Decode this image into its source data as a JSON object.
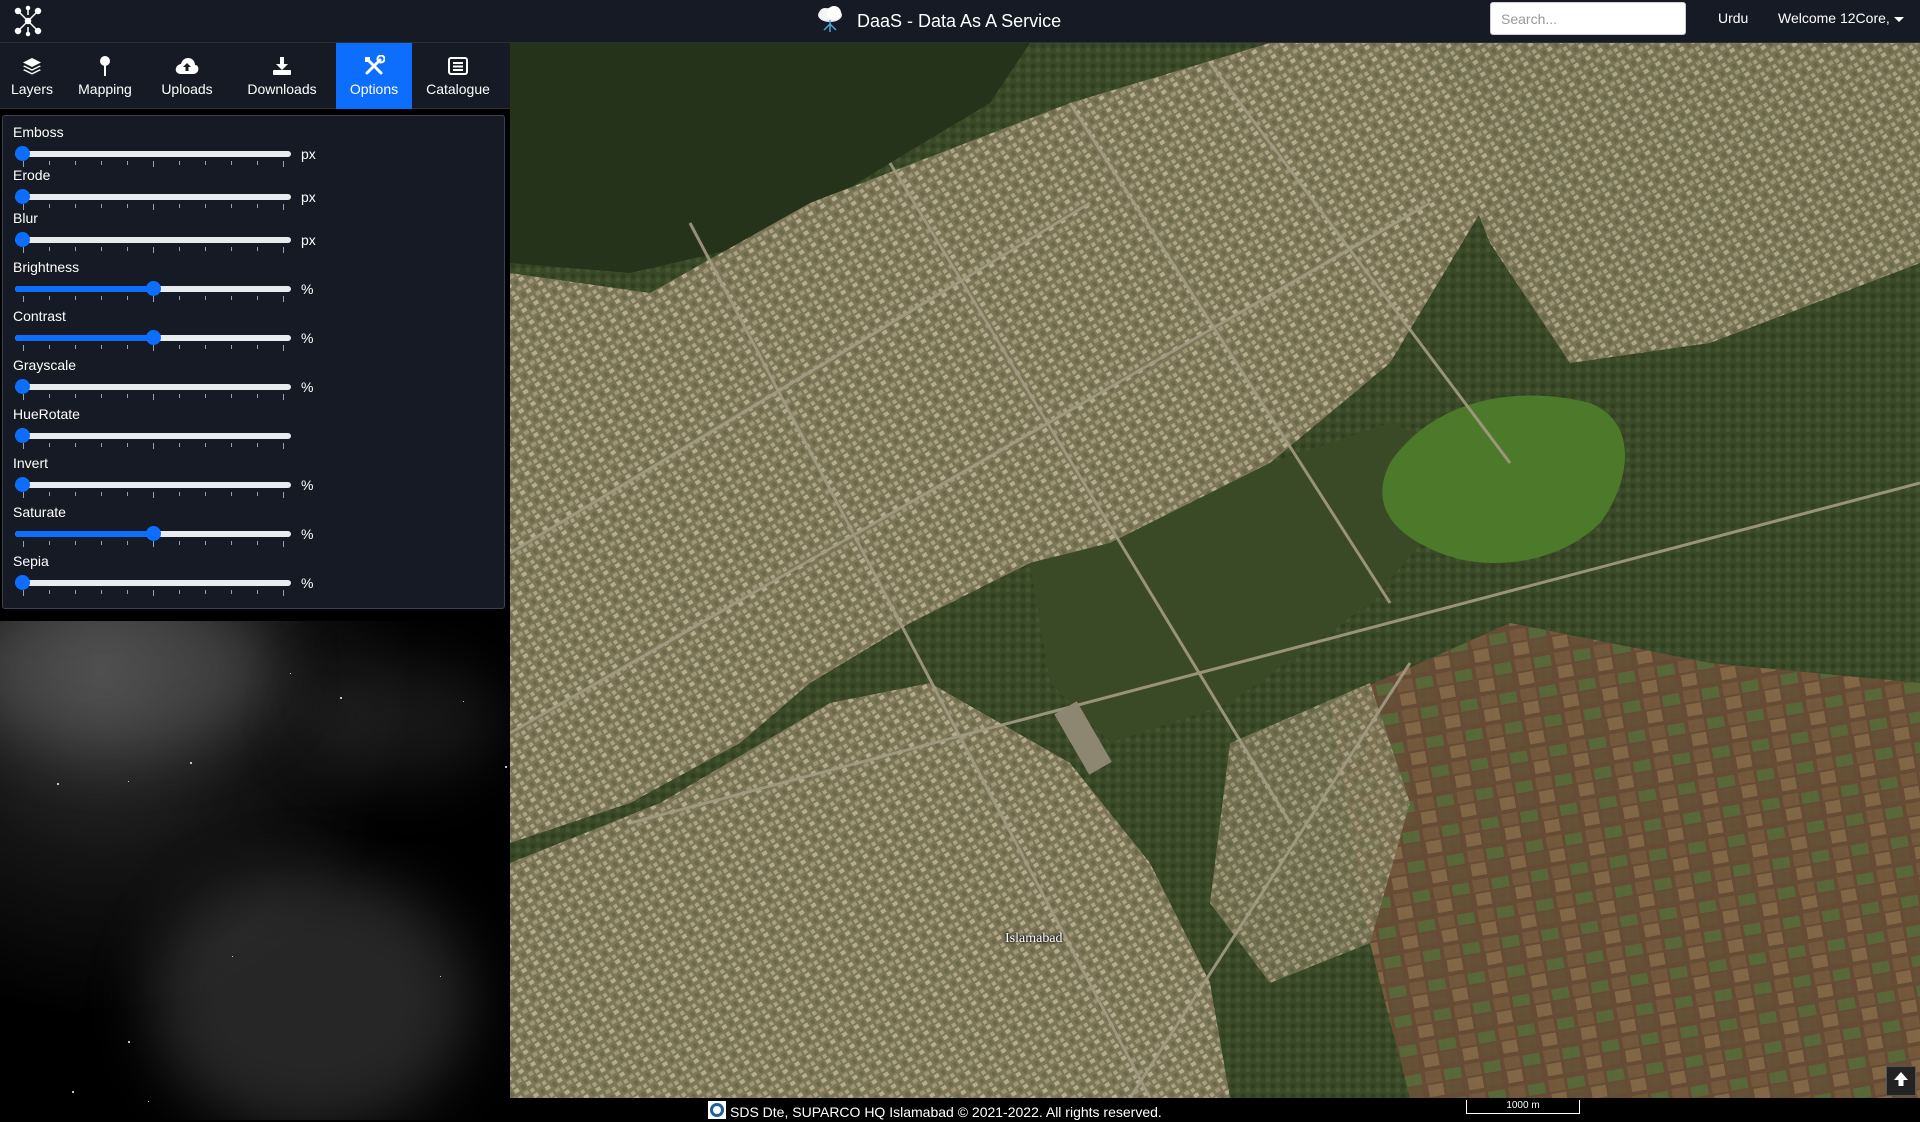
{
  "app": {
    "title": "DaaS - Data As A Service",
    "logo": "network-nodes-icon",
    "brand_icon": "cloud-tree-icon"
  },
  "header": {
    "search_placeholder": "Search...",
    "language": "Urdu",
    "welcome": "Welcome 12Core,"
  },
  "tabs": [
    {
      "label": "Layers",
      "icon": "layers-icon",
      "active": false
    },
    {
      "label": "Mapping",
      "icon": "pin-icon",
      "active": false
    },
    {
      "label": "Uploads",
      "icon": "cloud-upload-icon",
      "active": false
    },
    {
      "label": "Downloads",
      "icon": "download-icon",
      "active": false
    },
    {
      "label": "Options",
      "icon": "tools-icon",
      "active": true
    },
    {
      "label": "Catalogue",
      "icon": "list-icon",
      "active": false
    }
  ],
  "options": [
    {
      "label": "Emboss",
      "unit": "px",
      "value": 0
    },
    {
      "label": "Erode",
      "unit": "px",
      "value": 0
    },
    {
      "label": "Blur",
      "unit": "px",
      "value": 0
    },
    {
      "label": "Brightness",
      "unit": "%",
      "value": 0.5
    },
    {
      "label": "Contrast",
      "unit": "%",
      "value": 0.5
    },
    {
      "label": "Grayscale",
      "unit": "%",
      "value": 0
    },
    {
      "label": "HueRotate",
      "unit": "",
      "value": 0
    },
    {
      "label": "Invert",
      "unit": "%",
      "value": 0
    },
    {
      "label": "Saturate",
      "unit": "%",
      "value": 0.5
    },
    {
      "label": "Sepia",
      "unit": "%",
      "value": 0
    }
  ],
  "map": {
    "city_label": "Islamabad",
    "scale": "1000 m"
  },
  "footer": {
    "text": "SDS Dte, SUPARCO HQ Islamabad © 2021-2022. All rights reserved."
  },
  "colors": {
    "accent": "#0d6efd",
    "topbar": "#161a24"
  }
}
